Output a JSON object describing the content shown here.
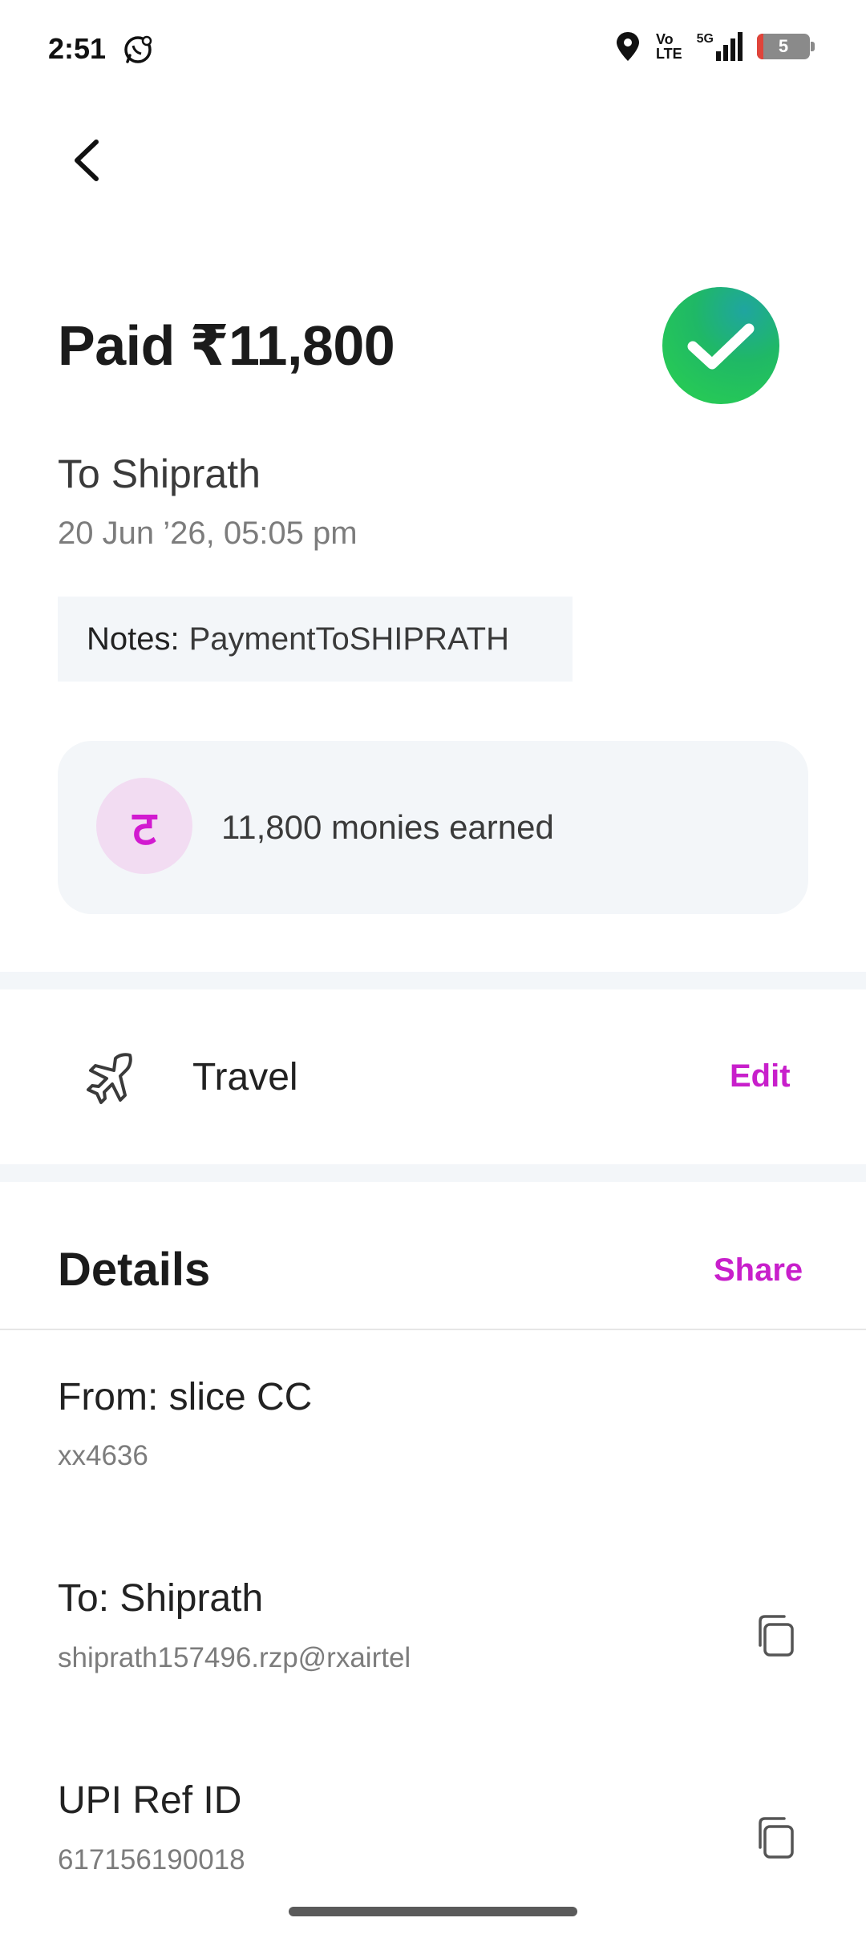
{
  "status_bar": {
    "time": "2:51",
    "network_line1": "Vo",
    "network_line2": "LTE",
    "network_type": "5G",
    "battery": "5"
  },
  "payment": {
    "title": "Paid ₹11,800",
    "recipient": "To Shiprath",
    "datetime": "20 Jun ’26, 05:05 pm",
    "notes_label": "Notes:",
    "notes_value": "PaymentToSHIPRATH"
  },
  "monies": {
    "icon_glyph": "ट",
    "text": "11,800 monies earned"
  },
  "category": {
    "icon": "airplane-icon",
    "label": "Travel",
    "edit_label": "Edit"
  },
  "details": {
    "title": "Details",
    "share_label": "Share",
    "rows": [
      {
        "title": "From: slice CC",
        "sub": "xx4636"
      },
      {
        "title": "To: Shiprath",
        "sub": "shiprath157496.rzp@rxairtel"
      },
      {
        "title": "UPI Ref ID",
        "sub": "617156190018"
      }
    ]
  },
  "colors": {
    "accent": "#c81fcb",
    "success": "#2ad14f",
    "card_bg": "#f3f6f9"
  }
}
